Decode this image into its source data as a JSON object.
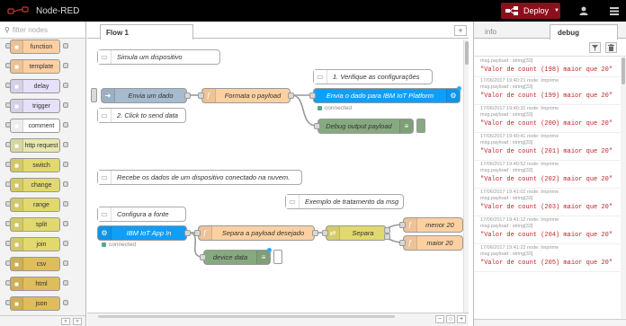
{
  "header": {
    "title": "Node-RED",
    "deploy_label": "Deploy"
  },
  "palette": {
    "filter_placeholder": "filter nodes",
    "nodes": [
      {
        "label": "function",
        "color": "#fdd0a2"
      },
      {
        "label": "template",
        "color": "#fdd0a2"
      },
      {
        "label": "delay",
        "color": "#e6e0f8"
      },
      {
        "label": "trigger",
        "color": "#e6e0f8"
      },
      {
        "label": "comment",
        "color": "#ffffff"
      },
      {
        "label": "http request",
        "color": "#e7e7ae"
      },
      {
        "label": "switch",
        "color": "#e2d96e"
      },
      {
        "label": "change",
        "color": "#e2d96e"
      },
      {
        "label": "range",
        "color": "#e2d96e"
      },
      {
        "label": "split",
        "color": "#e2d96e"
      },
      {
        "label": "join",
        "color": "#e2d96e"
      },
      {
        "label": "csv",
        "color": "#debd5c"
      },
      {
        "label": "html",
        "color": "#debd5c"
      },
      {
        "label": "json",
        "color": "#debd5c"
      }
    ]
  },
  "workspace": {
    "tab_label": "Flow 1",
    "comments": {
      "c1": "Simula um dispositivo",
      "c2": "1. Verifique as configurações",
      "c3": "2. Click to send data",
      "c4": "Recebe os dados de um dispositivo conectado na nuvem.",
      "c5": "Exemplo de tratamento da msg",
      "c6": "Configura a fonte"
    },
    "nodes": {
      "inject": "Envia um dado",
      "formata": "Formata o payload",
      "iot_out": "Envia o dado para IBM IoT Platform",
      "debug1": "Debug output payload",
      "iot_in": "IBM IoT App In",
      "separa_payload": "Separa a payload desejado",
      "separa": "Separa",
      "menor": "menor 20",
      "maior": "maior 20",
      "device_data": "device data"
    },
    "status_connected": "connected",
    "colors": {
      "inject": "#a6bbcf",
      "function": "#fdd0a2",
      "iot": "#0f9ef8",
      "debug": "#87a980",
      "switch": "#e2d96e"
    }
  },
  "sidebar": {
    "tabs": [
      "info",
      "debug"
    ],
    "messages": [
      {
        "meta": "",
        "topic": "msg.payload : string[33]",
        "value": "\"Valor de count (198) maior que 20\""
      },
      {
        "meta": "17/06/2017 19:40:21   node: Imprime",
        "topic": "msg.payload : string[33]",
        "value": "\"Valor de count (199) maior que 20\""
      },
      {
        "meta": "17/06/2017 19:40:31   node: Imprime",
        "topic": "msg.payload : string[33]",
        "value": "\"Valor de count (200) maior que 20\""
      },
      {
        "meta": "17/06/2017 19:40:41   node: Imprime",
        "topic": "msg.payload : string[33]",
        "value": "\"Valor de count (201) maior que 20\""
      },
      {
        "meta": "17/06/2017 19:40:52   node: Imprime",
        "topic": "msg.payload : string[33]",
        "value": "\"Valor de count (202) maior que 20\""
      },
      {
        "meta": "17/06/2017 19:41:02   node: Imprime",
        "topic": "msg.payload : string[33]",
        "value": "\"Valor de count (203) maior que 20\""
      },
      {
        "meta": "17/06/2017 19:41:12   node: Imprime",
        "topic": "msg.payload : string[33]",
        "value": "\"Valor de count (204) maior que 20\""
      },
      {
        "meta": "17/06/2017 19:41:22   node: Imprime",
        "topic": "msg.payload : string[33]",
        "value": "\"Valor de count (205) maior que 20\""
      }
    ]
  }
}
